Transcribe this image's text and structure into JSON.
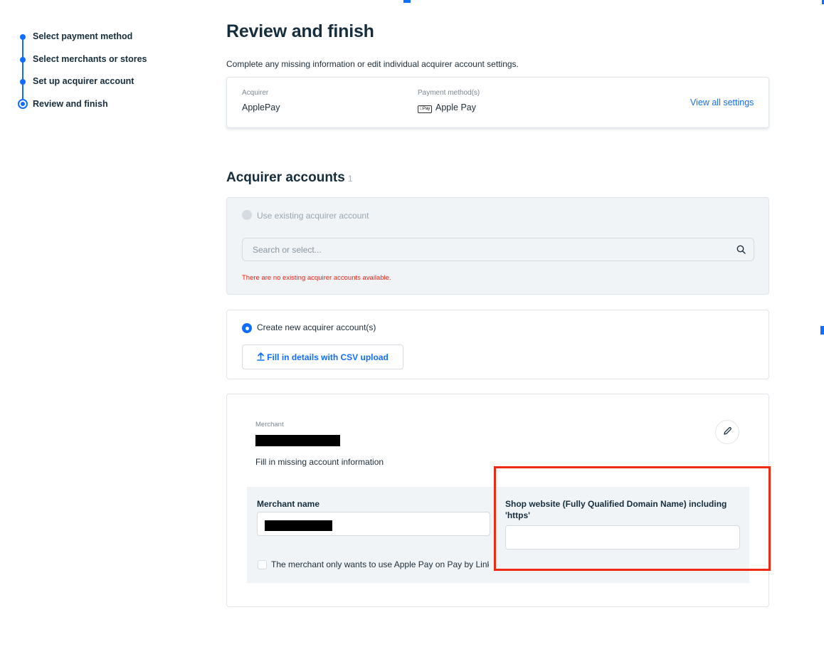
{
  "stepper": {
    "steps": [
      {
        "label": "Select payment method"
      },
      {
        "label": "Select merchants or stores"
      },
      {
        "label": "Set up acquirer account"
      },
      {
        "label": "Review and finish"
      }
    ]
  },
  "header": {
    "title": "Review and finish",
    "subtitle": "Complete any missing information or edit individual acquirer account settings."
  },
  "summary": {
    "acquirer_label": "Acquirer",
    "acquirer_value": "ApplePay",
    "payment_label": "Payment method(s)",
    "payment_badge": "Pay",
    "payment_value": "Apple Pay",
    "view_all_link": "View all settings"
  },
  "accounts": {
    "title": "Acquirer accounts",
    "count": "1",
    "existing_option": "Use existing acquirer account",
    "search_placeholder": "Search or select...",
    "error": "There are no existing acquirer accounts available.",
    "create_option": "Create new acquirer account(s)",
    "csv_button": "Fill in details with CSV upload"
  },
  "merchant": {
    "label": "Merchant",
    "fill_missing": "Fill in missing account information",
    "name_field_label": "Merchant name",
    "website_field_label": "Shop website (Fully Qualified Domain Name) including 'https'",
    "website_value": "",
    "checkbox_label": "The merchant only wants to use Apple Pay on Pay by Link"
  },
  "colors": {
    "accent": "#116dff",
    "error": "#e62214",
    "highlight": "#ee2a12"
  }
}
